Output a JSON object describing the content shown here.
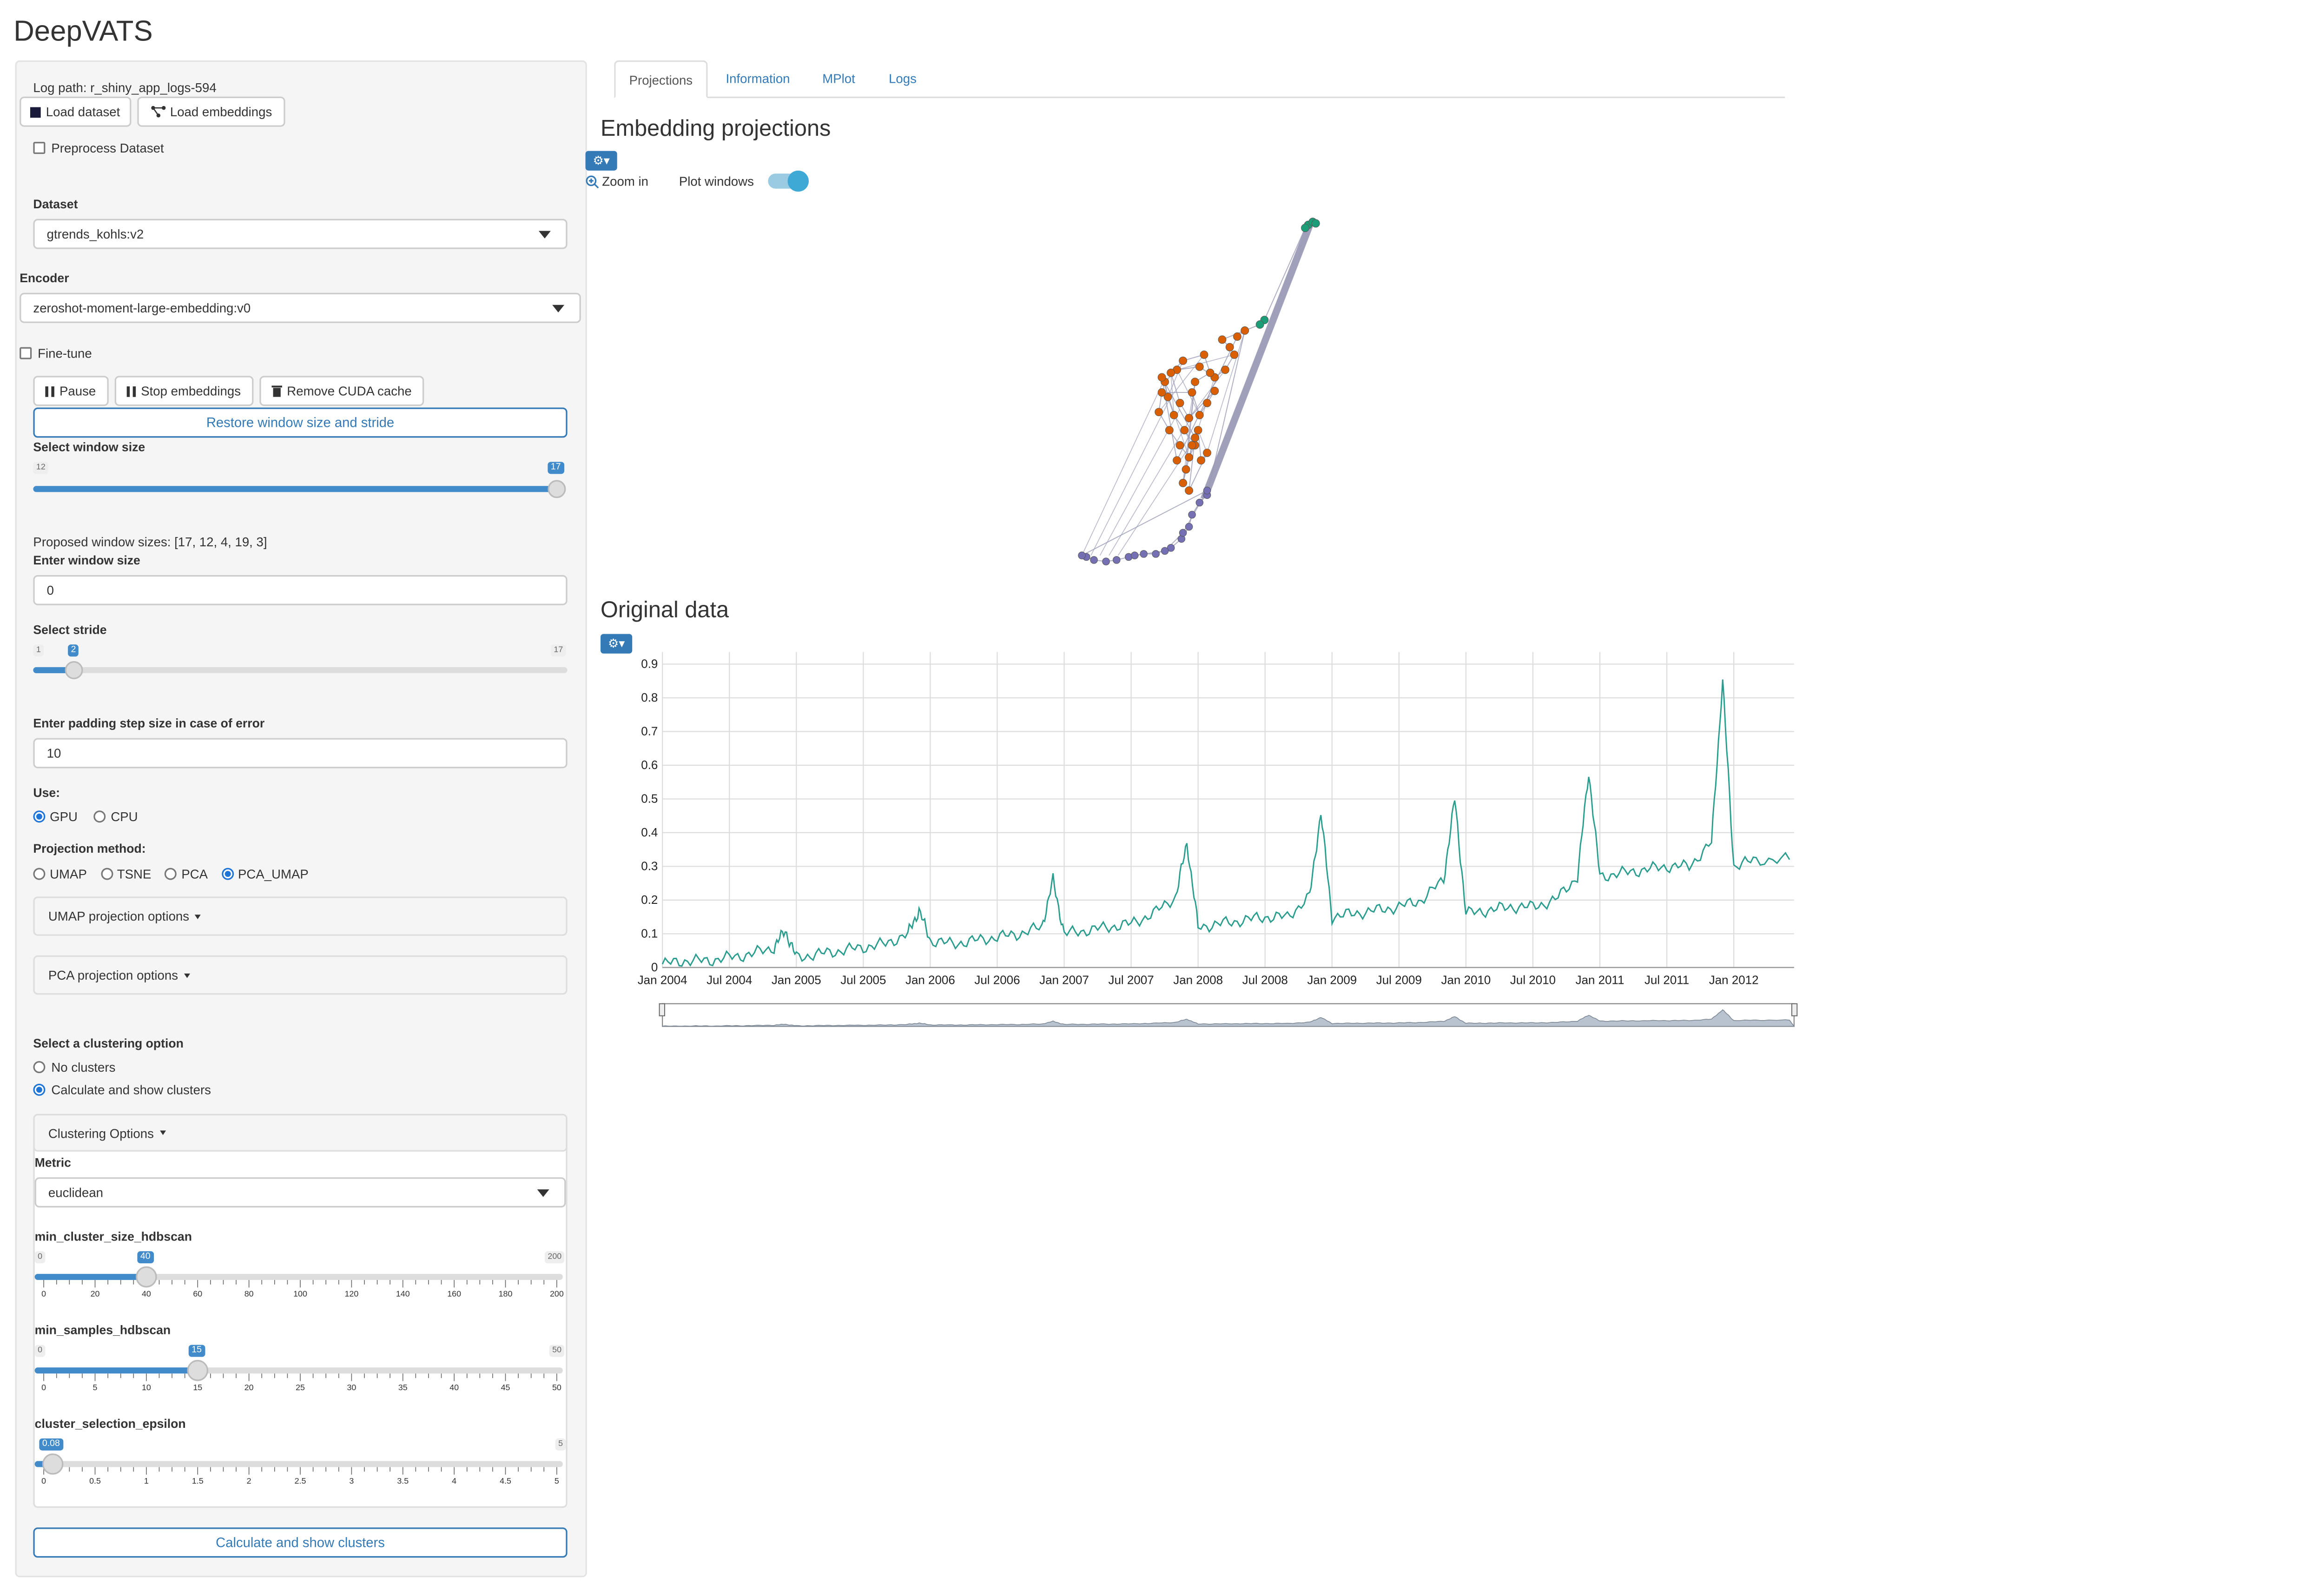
{
  "app": {
    "title": "DeepVATS"
  },
  "sidebar": {
    "log_path": "Log path: r_shiny_app_logs-594",
    "load_dataset_label": "Load dataset",
    "load_embeddings_label": "Load embeddings",
    "preprocess_label": "Preprocess Dataset",
    "preprocess_checked": false,
    "dataset_label": "Dataset",
    "dataset_value": "gtrends_kohls:v2",
    "encoder_label": "Encoder",
    "encoder_value": "zeroshot-moment-large-embedding:v0",
    "finetune_label": "Fine-tune",
    "finetune_checked": false,
    "pause_label": "Pause",
    "stop_label": "Stop embeddings",
    "remove_cuda_label": "Remove CUDA cache",
    "restore_label": "Restore window size and stride",
    "window_slider": {
      "label": "Select window size",
      "min": "12",
      "max": "17",
      "value": "17",
      "fraction": 1.0
    },
    "proposed_sizes": "Proposed window sizes: [17, 12, 4, 19, 3]",
    "enter_window_label": "Enter window size",
    "enter_window_value": "0",
    "stride_slider": {
      "label": "Select stride",
      "min": "1",
      "max": "17",
      "value": "2",
      "fraction": 0.0625
    },
    "padding_label": "Enter padding step size in case of error",
    "padding_value": "10",
    "use_label": "Use:",
    "use_options": [
      "GPU",
      "CPU"
    ],
    "use_selected": "GPU",
    "projection_label": "Projection method:",
    "projection_options": [
      "UMAP",
      "TSNE",
      "PCA",
      "PCA_UMAP"
    ],
    "projection_selected": "PCA_UMAP",
    "umap_options_label": "UMAP projection options",
    "pca_options_label": "PCA projection options",
    "clustering_label": "Select a clustering option",
    "clustering_options": [
      "No clusters",
      "Calculate and show clusters"
    ],
    "clustering_selected": "Calculate and show clusters",
    "clustering_panel_label": "Clustering Options",
    "metric_label": "Metric",
    "metric_value": "euclidean",
    "min_cluster": {
      "label": "min_cluster_size_hdbscan",
      "min": "0",
      "max": "200",
      "value": "40",
      "fraction": 0.2,
      "ticks": [
        "0",
        "20",
        "40",
        "60",
        "80",
        "100",
        "120",
        "140",
        "160",
        "180",
        "200"
      ]
    },
    "min_samples": {
      "label": "min_samples_hdbscan",
      "min": "0",
      "max": "50",
      "value": "15",
      "fraction": 0.3,
      "ticks": [
        "0",
        "5",
        "10",
        "15",
        "20",
        "25",
        "30",
        "35",
        "40",
        "45",
        "50"
      ]
    },
    "epsilon": {
      "label": "cluster_selection_epsilon",
      "max": "5",
      "value": "0.08",
      "fraction": 0.016,
      "ticks": [
        "0",
        "0.5",
        "1",
        "1.5",
        "2",
        "2.5",
        "3",
        "3.5",
        "4",
        "4.5",
        "5"
      ]
    },
    "calc_button_label": "Calculate and show clusters"
  },
  "tabs": [
    {
      "label": "Projections",
      "active": true
    },
    {
      "label": "Information",
      "active": false
    },
    {
      "label": "MPlot",
      "active": false
    },
    {
      "label": "Logs",
      "active": false
    }
  ],
  "projections": {
    "title": "Embedding projections",
    "zoom_label": "Zoom in",
    "plot_windows_label": "Plot windows",
    "plot_windows_on": true,
    "colors": {
      "teal": "#1b9e77",
      "orange": "#d95f02",
      "purple": "#7570b3",
      "edge": "#9a9ab6"
    }
  },
  "original": {
    "title": "Original data",
    "line_color": "#2a9d8f"
  },
  "chart_data": {
    "type": "line",
    "title": "",
    "xlabel": "",
    "ylabel": "",
    "ylim": [
      0,
      0.9
    ],
    "y_ticks": [
      "0",
      "0.1",
      "0.2",
      "0.3",
      "0.4",
      "0.5",
      "0.6",
      "0.7",
      "0.8",
      "0.9"
    ],
    "x_tick_labels": [
      "Jan 2004",
      "Jul 2004",
      "Jan 2005",
      "Jul 2005",
      "Jan 2006",
      "Jul 2006",
      "Jan 2007",
      "Jul 2007",
      "Jan 2008",
      "Jul 2008",
      "Jan 2009",
      "Jul 2009",
      "Jan 2010",
      "Jul 2010",
      "Jan 2011",
      "Jul 2011",
      "Jan 2012"
    ],
    "xlim": [
      "2004-01",
      "2012-06"
    ],
    "grid": true,
    "series": [
      {
        "x": [
          "2004-01",
          "2004-03",
          "2004-05",
          "2004-07",
          "2004-09",
          "2004-11",
          "2004-12",
          "2005-01",
          "2005-03",
          "2005-05",
          "2005-07",
          "2005-09",
          "2005-11",
          "2005-12",
          "2006-01",
          "2006-03",
          "2006-05",
          "2006-07",
          "2006-09",
          "2006-11",
          "2006-12",
          "2007-01",
          "2007-03",
          "2007-05",
          "2007-07",
          "2007-09",
          "2007-11",
          "2007-12",
          "2008-01",
          "2008-03",
          "2008-05",
          "2008-07",
          "2008-09",
          "2008-11",
          "2008-12",
          "2009-01",
          "2009-03",
          "2009-05",
          "2009-07",
          "2009-09",
          "2009-11",
          "2009-12",
          "2010-01",
          "2010-03",
          "2010-05",
          "2010-07",
          "2010-09",
          "2010-11",
          "2010-12",
          "2011-01",
          "2011-03",
          "2011-05",
          "2011-07",
          "2011-09",
          "2011-11",
          "2011-12",
          "2012-01",
          "2012-03",
          "2012-06"
        ],
        "values": [
          0.01,
          0.02,
          0.02,
          0.03,
          0.04,
          0.06,
          0.11,
          0.03,
          0.04,
          0.05,
          0.06,
          0.07,
          0.1,
          0.17,
          0.08,
          0.07,
          0.08,
          0.09,
          0.1,
          0.12,
          0.26,
          0.1,
          0.11,
          0.12,
          0.13,
          0.16,
          0.21,
          0.37,
          0.12,
          0.13,
          0.14,
          0.15,
          0.15,
          0.21,
          0.46,
          0.15,
          0.16,
          0.17,
          0.18,
          0.2,
          0.26,
          0.5,
          0.16,
          0.17,
          0.18,
          0.18,
          0.2,
          0.27,
          0.58,
          0.27,
          0.28,
          0.29,
          0.3,
          0.3,
          0.37,
          0.85,
          0.3,
          0.32,
          0.32
        ]
      }
    ]
  }
}
